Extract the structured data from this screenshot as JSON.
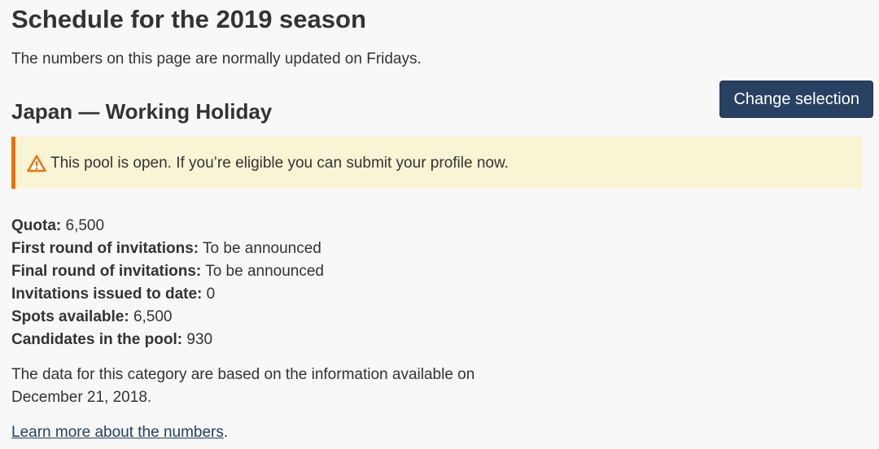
{
  "header": {
    "title": "Schedule for the 2019 season",
    "intro": "The numbers on this page are normally updated on Fridays."
  },
  "actions": {
    "change_selection_label": "Change selection"
  },
  "category": {
    "title": "Japan — Working Holiday"
  },
  "alert": {
    "icon": "warning-icon",
    "text": "This pool is open. If you’re eligible you can submit your profile now.",
    "accent_color": "#ee7100",
    "background_color": "#f9f4d4"
  },
  "facts": [
    {
      "label": "Quota:",
      "value": "6,500"
    },
    {
      "label": "First round of invitations:",
      "value": "To be announced"
    },
    {
      "label": "Final round of invitations:",
      "value": "To be announced"
    },
    {
      "label": "Invitations issued to date:",
      "value": "0"
    },
    {
      "label": "Spots available:",
      "value": "6,500"
    },
    {
      "label": "Candidates in the pool:",
      "value": "930"
    }
  ],
  "note": "The data for this category are based on the information available on December 21, 2018.",
  "learn_more": {
    "link_text": "Learn more about the numbers",
    "suffix": "."
  },
  "colors": {
    "button_background": "#284162",
    "page_background": "#f8f8f8",
    "text": "#333333"
  }
}
